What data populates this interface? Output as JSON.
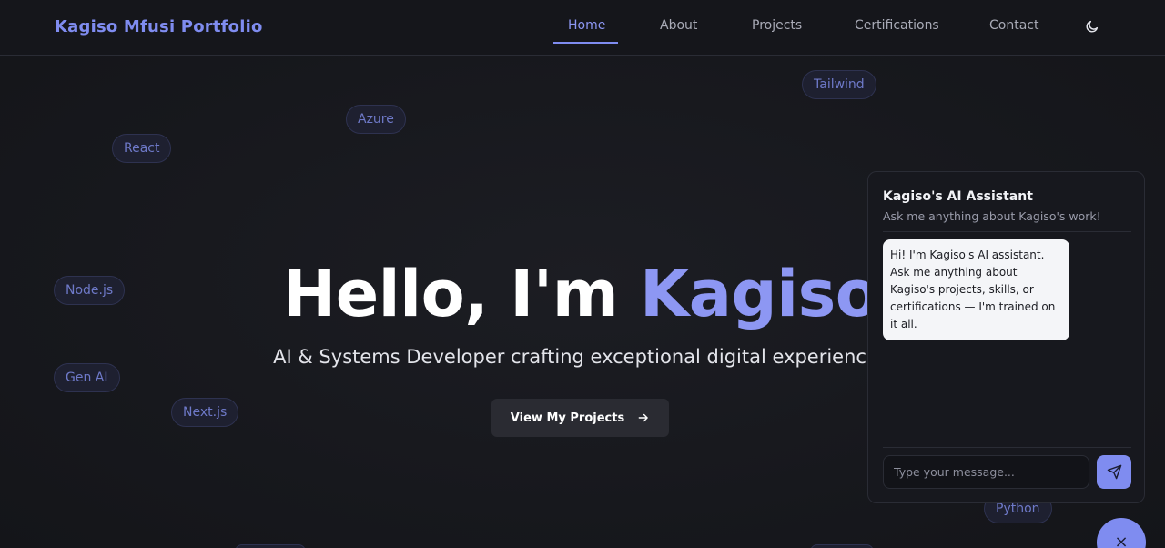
{
  "nav": {
    "brand": "Kagiso Mfusi Portfolio",
    "links": [
      "Home",
      "About",
      "Projects",
      "Certifications",
      "Contact"
    ],
    "active": "Home",
    "theme_icon": "moon-icon"
  },
  "chips": [
    "Tailwind",
    "Azure",
    "React",
    "Node.js",
    "Gen AI",
    "Next.js",
    "Python"
  ],
  "hero": {
    "greeting": "Hello, I'm ",
    "name": "Kagiso",
    "subtitle": "AI & Systems Developer crafting exceptional digital experiences",
    "cta_label": "View My Projects"
  },
  "chat": {
    "title": "Kagiso's AI Assistant",
    "subtitle": "Ask me anything about Kagiso's work!",
    "messages": [
      {
        "from": "assistant",
        "text": "Hi! I'm Kagiso's AI assistant. Ask me anything about Kagiso's projects, skills, or certifications — I'm trained on it all."
      }
    ],
    "input_placeholder": "Type your message...",
    "send_icon": "send-icon",
    "close_symbol": "×"
  },
  "colors": {
    "accent": "#7f8cf0",
    "background": "#16171c",
    "chip_text": "#6e79c8"
  }
}
